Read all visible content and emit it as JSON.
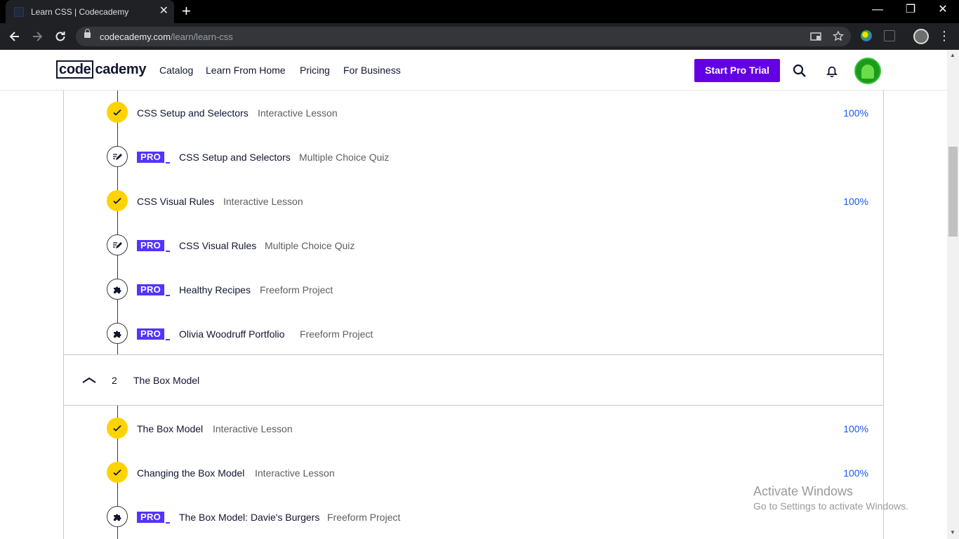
{
  "browser": {
    "tab_title": "Learn CSS | Codecademy",
    "tab_close": "✕",
    "new_tab": "+",
    "url_host": "codecademy.com",
    "url_path": "/learn/learn-css",
    "window_minimize": "—",
    "window_restore": "❐",
    "window_close": "✕"
  },
  "header": {
    "logo_code": "code",
    "logo_rest": "cademy",
    "nav": [
      "Catalog",
      "Learn From Home",
      "Pricing",
      "For Business"
    ],
    "cta": "Start Pro Trial"
  },
  "syllabus": {
    "pro_label": "PRO",
    "items_top": [
      {
        "title": "CSS Setup and Selectors",
        "type": "Interactive Lesson",
        "status": "complete",
        "pro": false,
        "progress": "100%"
      },
      {
        "title": "CSS Setup and Selectors",
        "type": "Multiple Choice Quiz",
        "status": "quiz",
        "pro": true,
        "progress": ""
      },
      {
        "title": "CSS Visual Rules",
        "type": "Interactive Lesson",
        "status": "complete",
        "pro": false,
        "progress": "100%"
      },
      {
        "title": "CSS Visual Rules",
        "type": "Multiple Choice Quiz",
        "status": "quiz",
        "pro": true,
        "progress": ""
      },
      {
        "title": "Healthy Recipes",
        "type": "Freeform Project",
        "status": "project",
        "pro": true,
        "progress": ""
      },
      {
        "title": "Olivia Woodruff Portfolio",
        "type": "Freeform Project",
        "status": "project",
        "pro": true,
        "progress": ""
      }
    ],
    "module": {
      "number": "2",
      "title": "The Box Model",
      "expanded": true
    },
    "items_module": [
      {
        "title": "The Box Model",
        "type": "Interactive Lesson",
        "status": "complete",
        "pro": false,
        "progress": "100%"
      },
      {
        "title": "Changing the Box Model",
        "type": "Interactive Lesson",
        "status": "complete",
        "pro": false,
        "progress": "100%"
      },
      {
        "title": "The Box Model: Davie's Burgers",
        "type": "Freeform Project",
        "status": "project",
        "pro": true,
        "progress": ""
      }
    ]
  },
  "watermark": {
    "line1": "Activate Windows",
    "line2": "Go to Settings to activate Windows."
  },
  "colors": {
    "brand_purple": "#6400e4",
    "pro_badge": "#5533ff",
    "complete_yellow": "#ffd300",
    "progress_blue": "#1557ff"
  }
}
